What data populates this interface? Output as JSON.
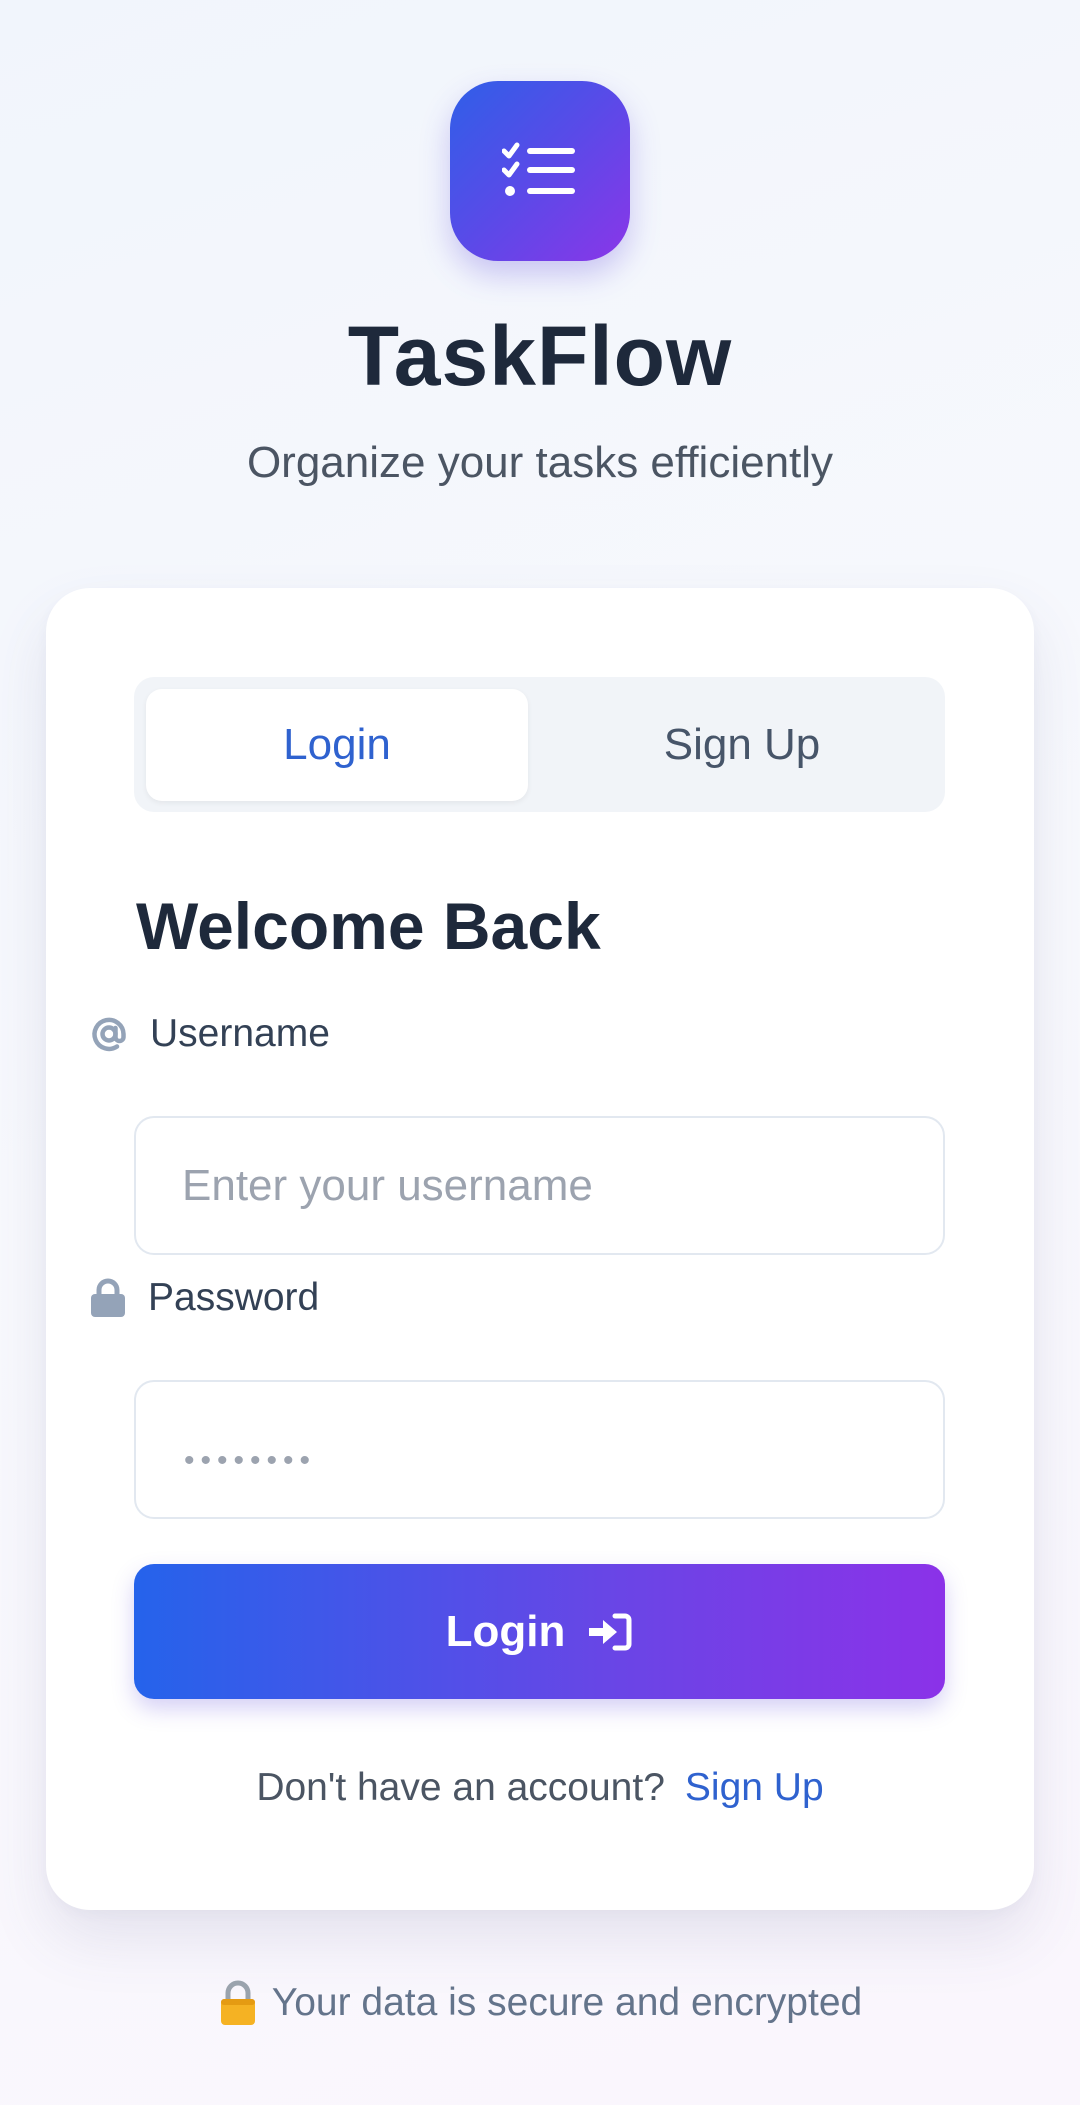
{
  "app": {
    "title": "TaskFlow",
    "subtitle": "Organize your tasks efficiently",
    "logo_icon": "task-list-icon"
  },
  "tabs": [
    {
      "label": "Login",
      "active": true
    },
    {
      "label": "Sign Up",
      "active": false
    }
  ],
  "form": {
    "heading": "Welcome Back",
    "username": {
      "label": "Username",
      "icon": "at-sign-icon",
      "placeholder": "Enter your username",
      "value": ""
    },
    "password": {
      "label": "Password",
      "icon": "lock-icon",
      "masked_value": "••••••••"
    },
    "submit": {
      "label": "Login",
      "icon": "sign-in-icon"
    },
    "signup_prompt": "Don't have an account?",
    "signup_link": "Sign Up"
  },
  "footer": {
    "text": "Your data is secure and encrypted",
    "icon": "padlock-emoji-icon"
  },
  "colors": {
    "accent": "#2f62cf",
    "gradient_start": "#2563eb",
    "gradient_end": "#8b32e8",
    "heading": "#1e293b"
  }
}
